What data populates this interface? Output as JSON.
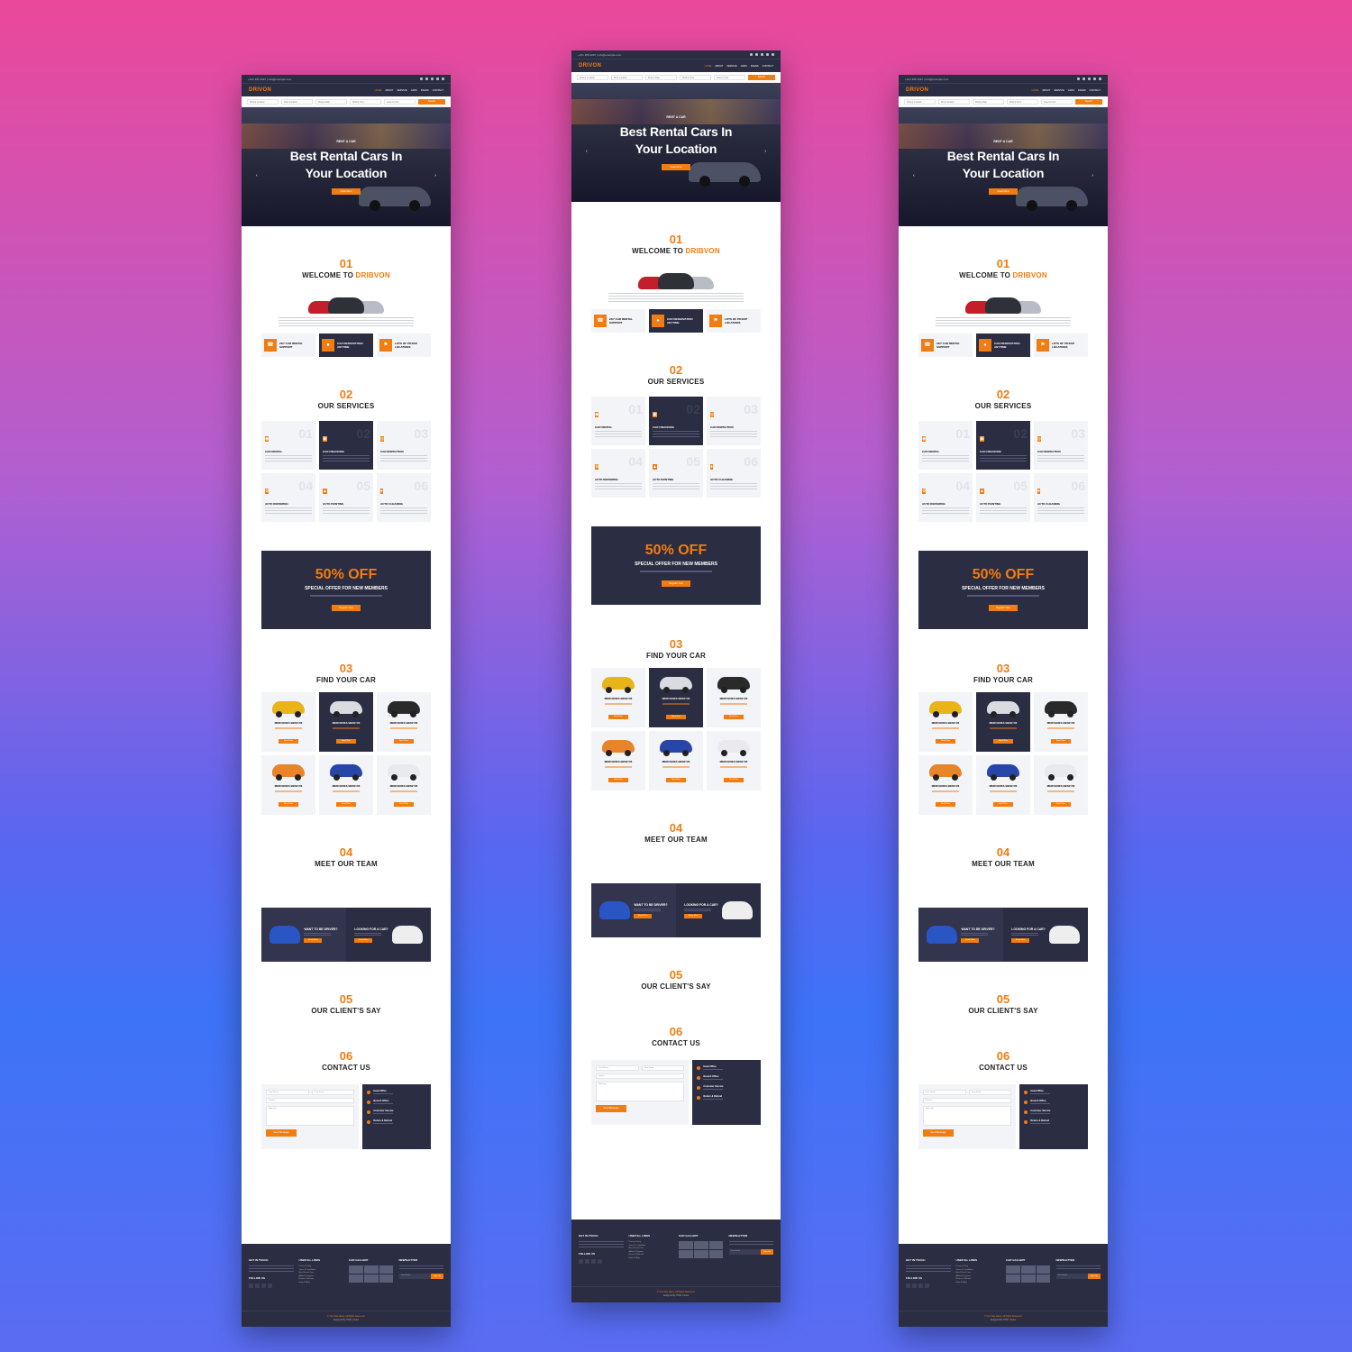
{
  "mockups": [
    {
      "id": "left"
    },
    {
      "id": "center"
    },
    {
      "id": "right"
    }
  ],
  "site": {
    "topbar": {
      "phone": "+101 355 4097",
      "email": "info@example.com"
    },
    "logo": "DRIVON",
    "menu": [
      "HOME",
      "ABOUT",
      "SERVICE",
      "CARS",
      "PAGES",
      "CONTACT"
    ],
    "search": {
      "fields": [
        "Pickup Location",
        "Drop Location",
        "Pickup Date",
        "Pickup Time",
        "Select A Car"
      ],
      "button": "Search"
    },
    "hero": {
      "subtitle": "RENT A CAR",
      "title_line1": "Best Rental Cars In",
      "title_line2": "Your Location",
      "cta": "Read More",
      "prev_icon": "chevron-left-icon",
      "next_icon": "chevron-right-icon"
    },
    "welcome": {
      "number": "01",
      "title_prefix": "WELCOME TO",
      "title_brand": "DRIBVON",
      "features": [
        "24/7 CAR RENTAL SUPPORT",
        "CAR RESERVATION ANYTIME",
        "LOTS OF PICKUP LOCATIONS"
      ]
    },
    "services": {
      "number": "02",
      "title": "OUR SERVICES",
      "items": [
        {
          "n": "01",
          "name": "CAR RENTAL"
        },
        {
          "n": "02",
          "name": "CAR FINANCING"
        },
        {
          "n": "03",
          "name": "CAR INSPECTION"
        },
        {
          "n": "04",
          "name": "AUTO REPAIRING"
        },
        {
          "n": "05",
          "name": "AUTO PAINTING"
        },
        {
          "n": "06",
          "name": "AUTO CLEANING"
        }
      ]
    },
    "offer": {
      "headline": "50% OFF",
      "subtitle": "SPECIAL OFFER FOR NEW MEMBERS",
      "cta": "Register Now"
    },
    "cars": {
      "number": "03",
      "title": "FIND YOUR CAR",
      "items": [
        {
          "name": "MERCEDES BENZ R3",
          "color": "#e8b418"
        },
        {
          "name": "MERCEDES BENZ R3",
          "color": "#d9dbe0"
        },
        {
          "name": "MERCEDES BENZ R3",
          "color": "#2a2a2a"
        },
        {
          "name": "MERCEDES BENZ R3",
          "color": "#e8842a"
        },
        {
          "name": "MERCEDES BENZ R3",
          "color": "#2846a8"
        },
        {
          "name": "MERCEDES BENZ R3",
          "color": "#e9e9ee"
        }
      ],
      "cta": "Book Now"
    },
    "team": {
      "number": "04",
      "title": "MEET OUR TEAM",
      "panels": [
        {
          "title": "WANT TO BE DRIVER?",
          "cta": "Read More",
          "car_color": "#2a55c4"
        },
        {
          "title": "LOOKING FOR A CAR?",
          "cta": "Read More",
          "car_color": "#eeeeee"
        }
      ]
    },
    "clients": {
      "number": "05",
      "title": "OUR CLIENT'S SAY"
    },
    "contact": {
      "number": "06",
      "title": "CONTACT US",
      "placeholders": {
        "name": "Your Name",
        "email": "Your Email",
        "subject": "Subject",
        "message": "Message"
      },
      "button": "Send Message",
      "info": [
        "Head Office",
        "Branch Office",
        "Customer Service",
        "Return & Refund"
      ]
    },
    "footer": {
      "cols": [
        "GET IN TOUCH",
        "USEFULL LINKS",
        "CAR GALLERY",
        "NEWSLETTER"
      ],
      "links": [
        "Privacy Policy",
        "Terms & Conditions",
        "Best Rental Cars",
        "Affiliate Program",
        "Return & Refund",
        "Help & FAQs"
      ],
      "follow": "FOLLOW US",
      "newsletter_placeholder": "Your Email",
      "newsletter_button": "Sign Up",
      "copyright": "© Your Site Name, All Rights Reserved.",
      "designed": "Designed By HTML Codex"
    },
    "colors": {
      "accent": "#f17c10",
      "dark": "#2b2d42"
    }
  }
}
